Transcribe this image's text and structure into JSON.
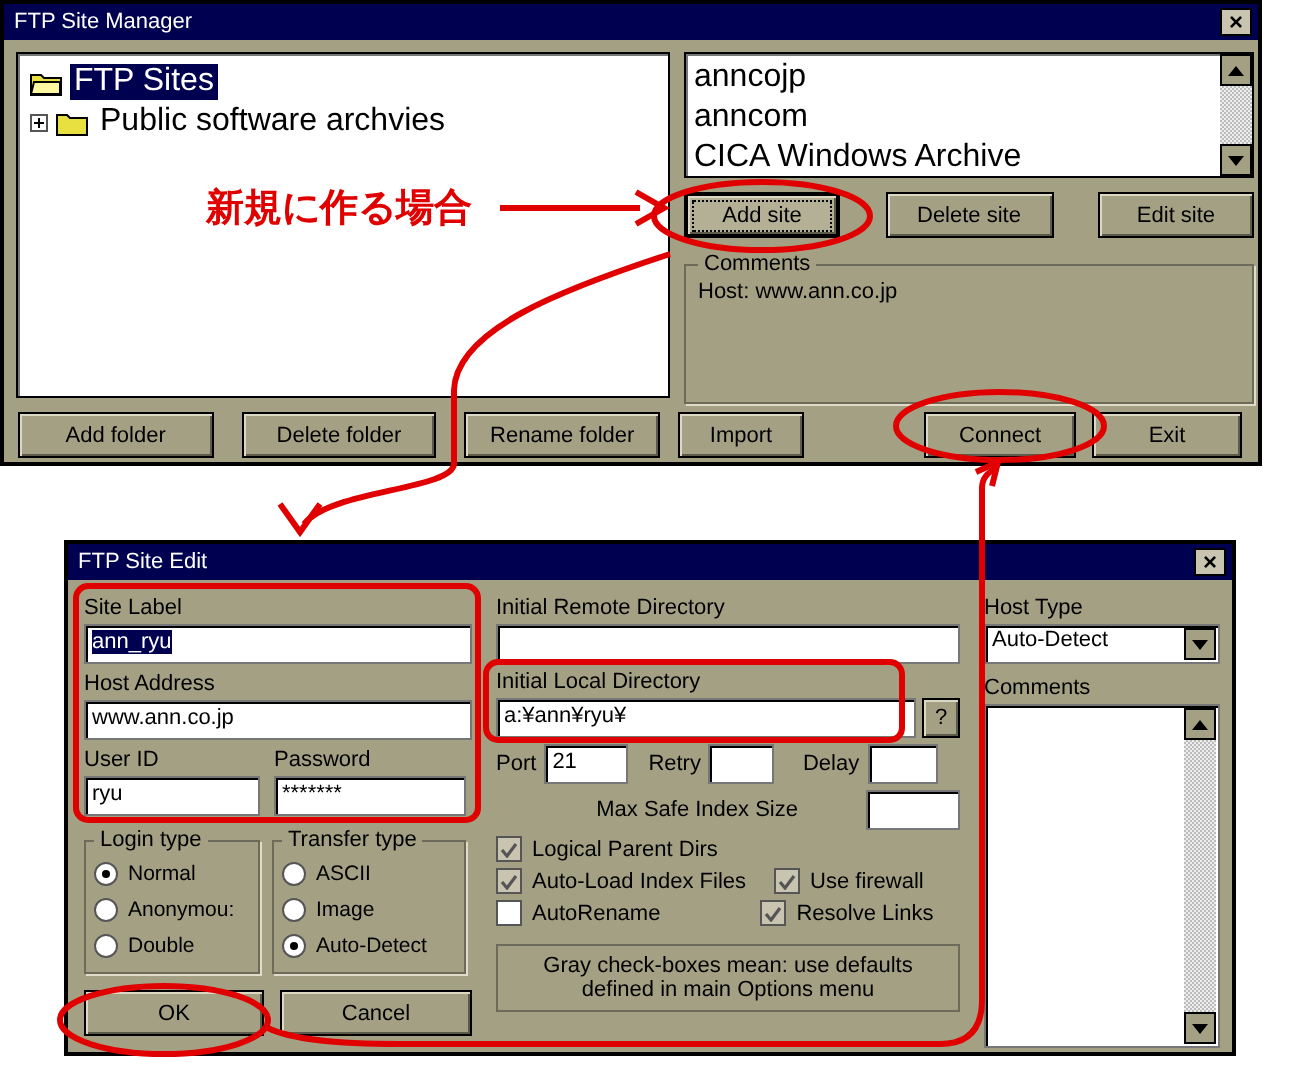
{
  "site_manager": {
    "title": "FTP Site Manager",
    "close": "×",
    "tree": [
      {
        "label": "FTP Sites",
        "selected": true,
        "children": [
          {
            "label": "Public software archvies",
            "selected": false,
            "expanded": false
          }
        ]
      }
    ],
    "sites": [
      "anncojp",
      "anncom",
      "CICA Windows Archive"
    ],
    "site_buttons": [
      {
        "label": "Add site",
        "focused": true
      },
      {
        "label": "Delete site",
        "focused": false
      },
      {
        "label": "Edit site",
        "focused": false
      }
    ],
    "comments": {
      "label": "Comments",
      "text": "Host: www.ann.co.jp"
    },
    "folder_buttons": [
      "Add folder",
      "Delete folder",
      "Rename folder",
      "Import"
    ],
    "dialog_buttons": [
      "Connect",
      "Exit"
    ]
  },
  "site_edit": {
    "title": "FTP Site Edit",
    "close": "×",
    "site_label": {
      "label": "Site Label",
      "value": "ann_ryu"
    },
    "host_address": {
      "label": "Host Address",
      "value": "www.ann.co.jp"
    },
    "user_id": {
      "label": "User ID",
      "value": "ryu"
    },
    "password": {
      "label": "Password",
      "value": "*******"
    },
    "login_type": {
      "label": "Login type",
      "options": [
        {
          "label": "Normal",
          "selected": true
        },
        {
          "label": "Anonymou:",
          "selected": false
        },
        {
          "label": "Double",
          "selected": false
        }
      ]
    },
    "transfer_type": {
      "label": "Transfer type",
      "options": [
        {
          "label": "ASCII",
          "selected": false
        },
        {
          "label": "Image",
          "selected": false
        },
        {
          "label": "Auto-Detect",
          "selected": true
        }
      ]
    },
    "remote_dir": {
      "label": "Initial Remote Directory"
    },
    "local_dir": {
      "label": "Initial Local Directory",
      "value": "a:¥ann¥ryu¥",
      "help": "?"
    },
    "port": {
      "label": "Port",
      "value": "21"
    },
    "retry": {
      "label": "Retry"
    },
    "delay": {
      "label": "Delay"
    },
    "max_index": {
      "label": "Max Safe Index Size"
    },
    "checkboxes": [
      {
        "label": "Logical Parent Dirs",
        "checked": true
      },
      {
        "label": "Auto-Load Index Files",
        "checked": true
      },
      {
        "label": "Use firewall",
        "checked": true
      },
      {
        "label": "AutoRename",
        "checked": false
      },
      {
        "label": "Resolve Links",
        "checked": true
      }
    ],
    "note": "Gray check-boxes mean: use defaults defined in main Options menu",
    "host_type": {
      "label": "Host Type",
      "value": "Auto-Detect"
    },
    "comments": {
      "label": "Comments"
    },
    "buttons": [
      "OK",
      "Cancel"
    ]
  },
  "annotation": {
    "label": "新規に作る場合"
  }
}
